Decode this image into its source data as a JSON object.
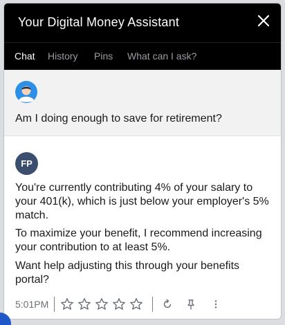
{
  "header": {
    "title": "Your Digital Money Assistant",
    "close_icon": "close-icon"
  },
  "tabs": [
    {
      "label": "Chat",
      "active": true
    },
    {
      "label": "History",
      "active": false
    },
    {
      "label": "Pins",
      "active": false
    },
    {
      "label": "What can I ask?",
      "active": false
    }
  ],
  "user_message": {
    "avatar": "user-avatar-icon",
    "text": "Am I doing enough to save for retirement?"
  },
  "assistant_message": {
    "avatar_initials": "FP",
    "paragraphs": [
      "You're currently contributing 4% of your salary to your 401(k), which is just below your employer's 5% match.",
      "To maximize your benefit, I recommend increasing your contribution to at least 5%.",
      "Want help adjusting this through your benefits portal?"
    ],
    "time": "5:01PM",
    "rating_max": 5,
    "rating_value": 0,
    "actions": [
      "refresh-icon",
      "pin-icon",
      "more-vertical-icon"
    ]
  },
  "colors": {
    "header_bg": "#000000",
    "fp_avatar_bg": "#3c4e6e",
    "accent_blue": "#1f57c8"
  }
}
